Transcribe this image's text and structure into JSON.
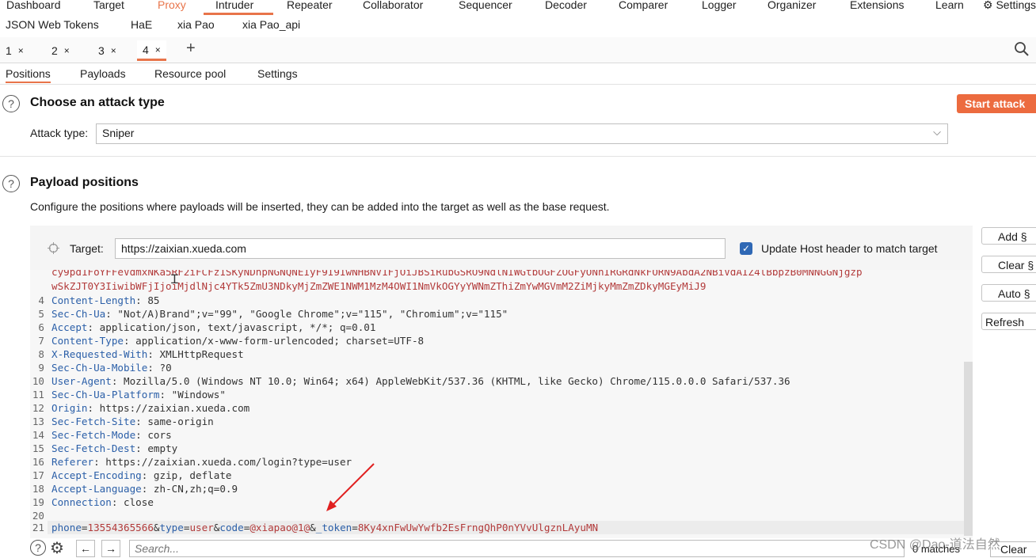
{
  "top_nav": [
    "Dashboard",
    "Target",
    "Proxy",
    "Intruder",
    "Repeater",
    "Collaborator",
    "Sequencer",
    "Decoder",
    "Comparer",
    "Logger",
    "Organizer",
    "Extensions",
    "Learn",
    "Settings"
  ],
  "sub_nav": [
    "JSON Web Tokens",
    "HaE",
    "xia Pao",
    "xia Pao_api"
  ],
  "tabs": [
    {
      "label": "1",
      "close": "×"
    },
    {
      "label": "2",
      "close": "×"
    },
    {
      "label": "3",
      "close": "×"
    },
    {
      "label": "4",
      "close": "×"
    }
  ],
  "add_tab": "+",
  "section_tabs": [
    "Positions",
    "Payloads",
    "Resource pool",
    "Settings"
  ],
  "attack": {
    "title": "Choose an attack type",
    "type_label": "Attack type:",
    "type_value": "Sniper",
    "start_button": "Start attack"
  },
  "positions": {
    "title": "Payload positions",
    "description": "Configure the positions where payloads will be inserted, they can be added into the target as well as the base request.",
    "target_label": "Target:",
    "target_value": "https://zaixian.xueda.com",
    "update_host_label": "Update Host header to match target",
    "update_host_checked": true
  },
  "side_buttons": [
    "Add §",
    "Clear §",
    "Auto §",
    "Refresh"
  ],
  "editor": {
    "partial_line_1": "cy9pd1FoYFFeVdmxNKa5RF2iFCFz1SKyNDhpNGNQNEIyF9I9IwNHBNV1FjOiJBSiRubGSRO9NdlNIWGtbOGFZOGFyONhIRGRdNkFORN9AbdA2NBiVdAIZ4lBbpzB0MNNGGNjgzp",
    "partial_line_2": "wSkZJT0Y3IiwibWFjIjoiMjdlNjc4YTk5ZmU3NDkyMjZmZWE1NWM1MzM4OWI1NmVkOGYyYWNmZThiZmYwMGVmM2ZiMjkyMmZmZDkyMGEyMiJ9",
    "lines": [
      {
        "n": "4",
        "key": "Content-Length",
        "val": " 85"
      },
      {
        "n": "5",
        "key": "Sec-Ch-Ua",
        "val": " \"Not/A)Brand\";v=\"99\", \"Google Chrome\";v=\"115\", \"Chromium\";v=\"115\""
      },
      {
        "n": "6",
        "key": "Accept",
        "val": " application/json, text/javascript, */*; q=0.01"
      },
      {
        "n": "7",
        "key": "Content-Type",
        "val": " application/x-www-form-urlencoded; charset=UTF-8"
      },
      {
        "n": "8",
        "key": "X-Requested-With",
        "val": " XMLHttpRequest"
      },
      {
        "n": "9",
        "key": "Sec-Ch-Ua-Mobile",
        "val": " ?0"
      },
      {
        "n": "10",
        "key": "User-Agent",
        "val": " Mozilla/5.0 (Windows NT 10.0; Win64; x64) AppleWebKit/537.36 (KHTML, like Gecko) Chrome/115.0.0.0 Safari/537.36"
      },
      {
        "n": "11",
        "key": "Sec-Ch-Ua-Platform",
        "val": " \"Windows\""
      },
      {
        "n": "12",
        "key": "Origin",
        "val": " https://zaixian.xueda.com"
      },
      {
        "n": "13",
        "key": "Sec-Fetch-Site",
        "val": " same-origin"
      },
      {
        "n": "14",
        "key": "Sec-Fetch-Mode",
        "val": " cors"
      },
      {
        "n": "15",
        "key": "Sec-Fetch-Dest",
        "val": " empty"
      },
      {
        "n": "16",
        "key": "Referer",
        "val": " https://zaixian.xueda.com/login?type=user"
      },
      {
        "n": "17",
        "key": "Accept-Encoding",
        "val": " gzip, deflate"
      },
      {
        "n": "18",
        "key": "Accept-Language",
        "val": " zh-CN,zh;q=0.9"
      },
      {
        "n": "19",
        "key": "Connection",
        "val": " close"
      },
      {
        "n": "20",
        "key": "",
        "val": ""
      }
    ],
    "body_line_num": "21",
    "body": [
      {
        "t": "phone",
        "c": "key"
      },
      {
        "t": "=",
        "c": "plain"
      },
      {
        "t": "13554365566",
        "c": "red"
      },
      {
        "t": "&",
        "c": "plain"
      },
      {
        "t": "type",
        "c": "key"
      },
      {
        "t": "=",
        "c": "plain"
      },
      {
        "t": "user",
        "c": "red"
      },
      {
        "t": "&",
        "c": "plain"
      },
      {
        "t": "code",
        "c": "key"
      },
      {
        "t": "=",
        "c": "plain"
      },
      {
        "t": "@xiapao@1@",
        "c": "red"
      },
      {
        "t": "&",
        "c": "plain"
      },
      {
        "t": "_token",
        "c": "key"
      },
      {
        "t": "=",
        "c": "plain"
      },
      {
        "t": "8Ky4xnFwUwYwfb2EsFrngQhP0nYVvUlgznLAyuMN",
        "c": "red"
      }
    ]
  },
  "bottom": {
    "search_placeholder": "Search...",
    "matches": "0 matches",
    "clear": "Clear"
  },
  "watermark": "CSDN @Dao-道法自然",
  "colors": {
    "accent": "#ec6b3f",
    "key": "#2b5fa8",
    "payload": "#b23a3a"
  }
}
